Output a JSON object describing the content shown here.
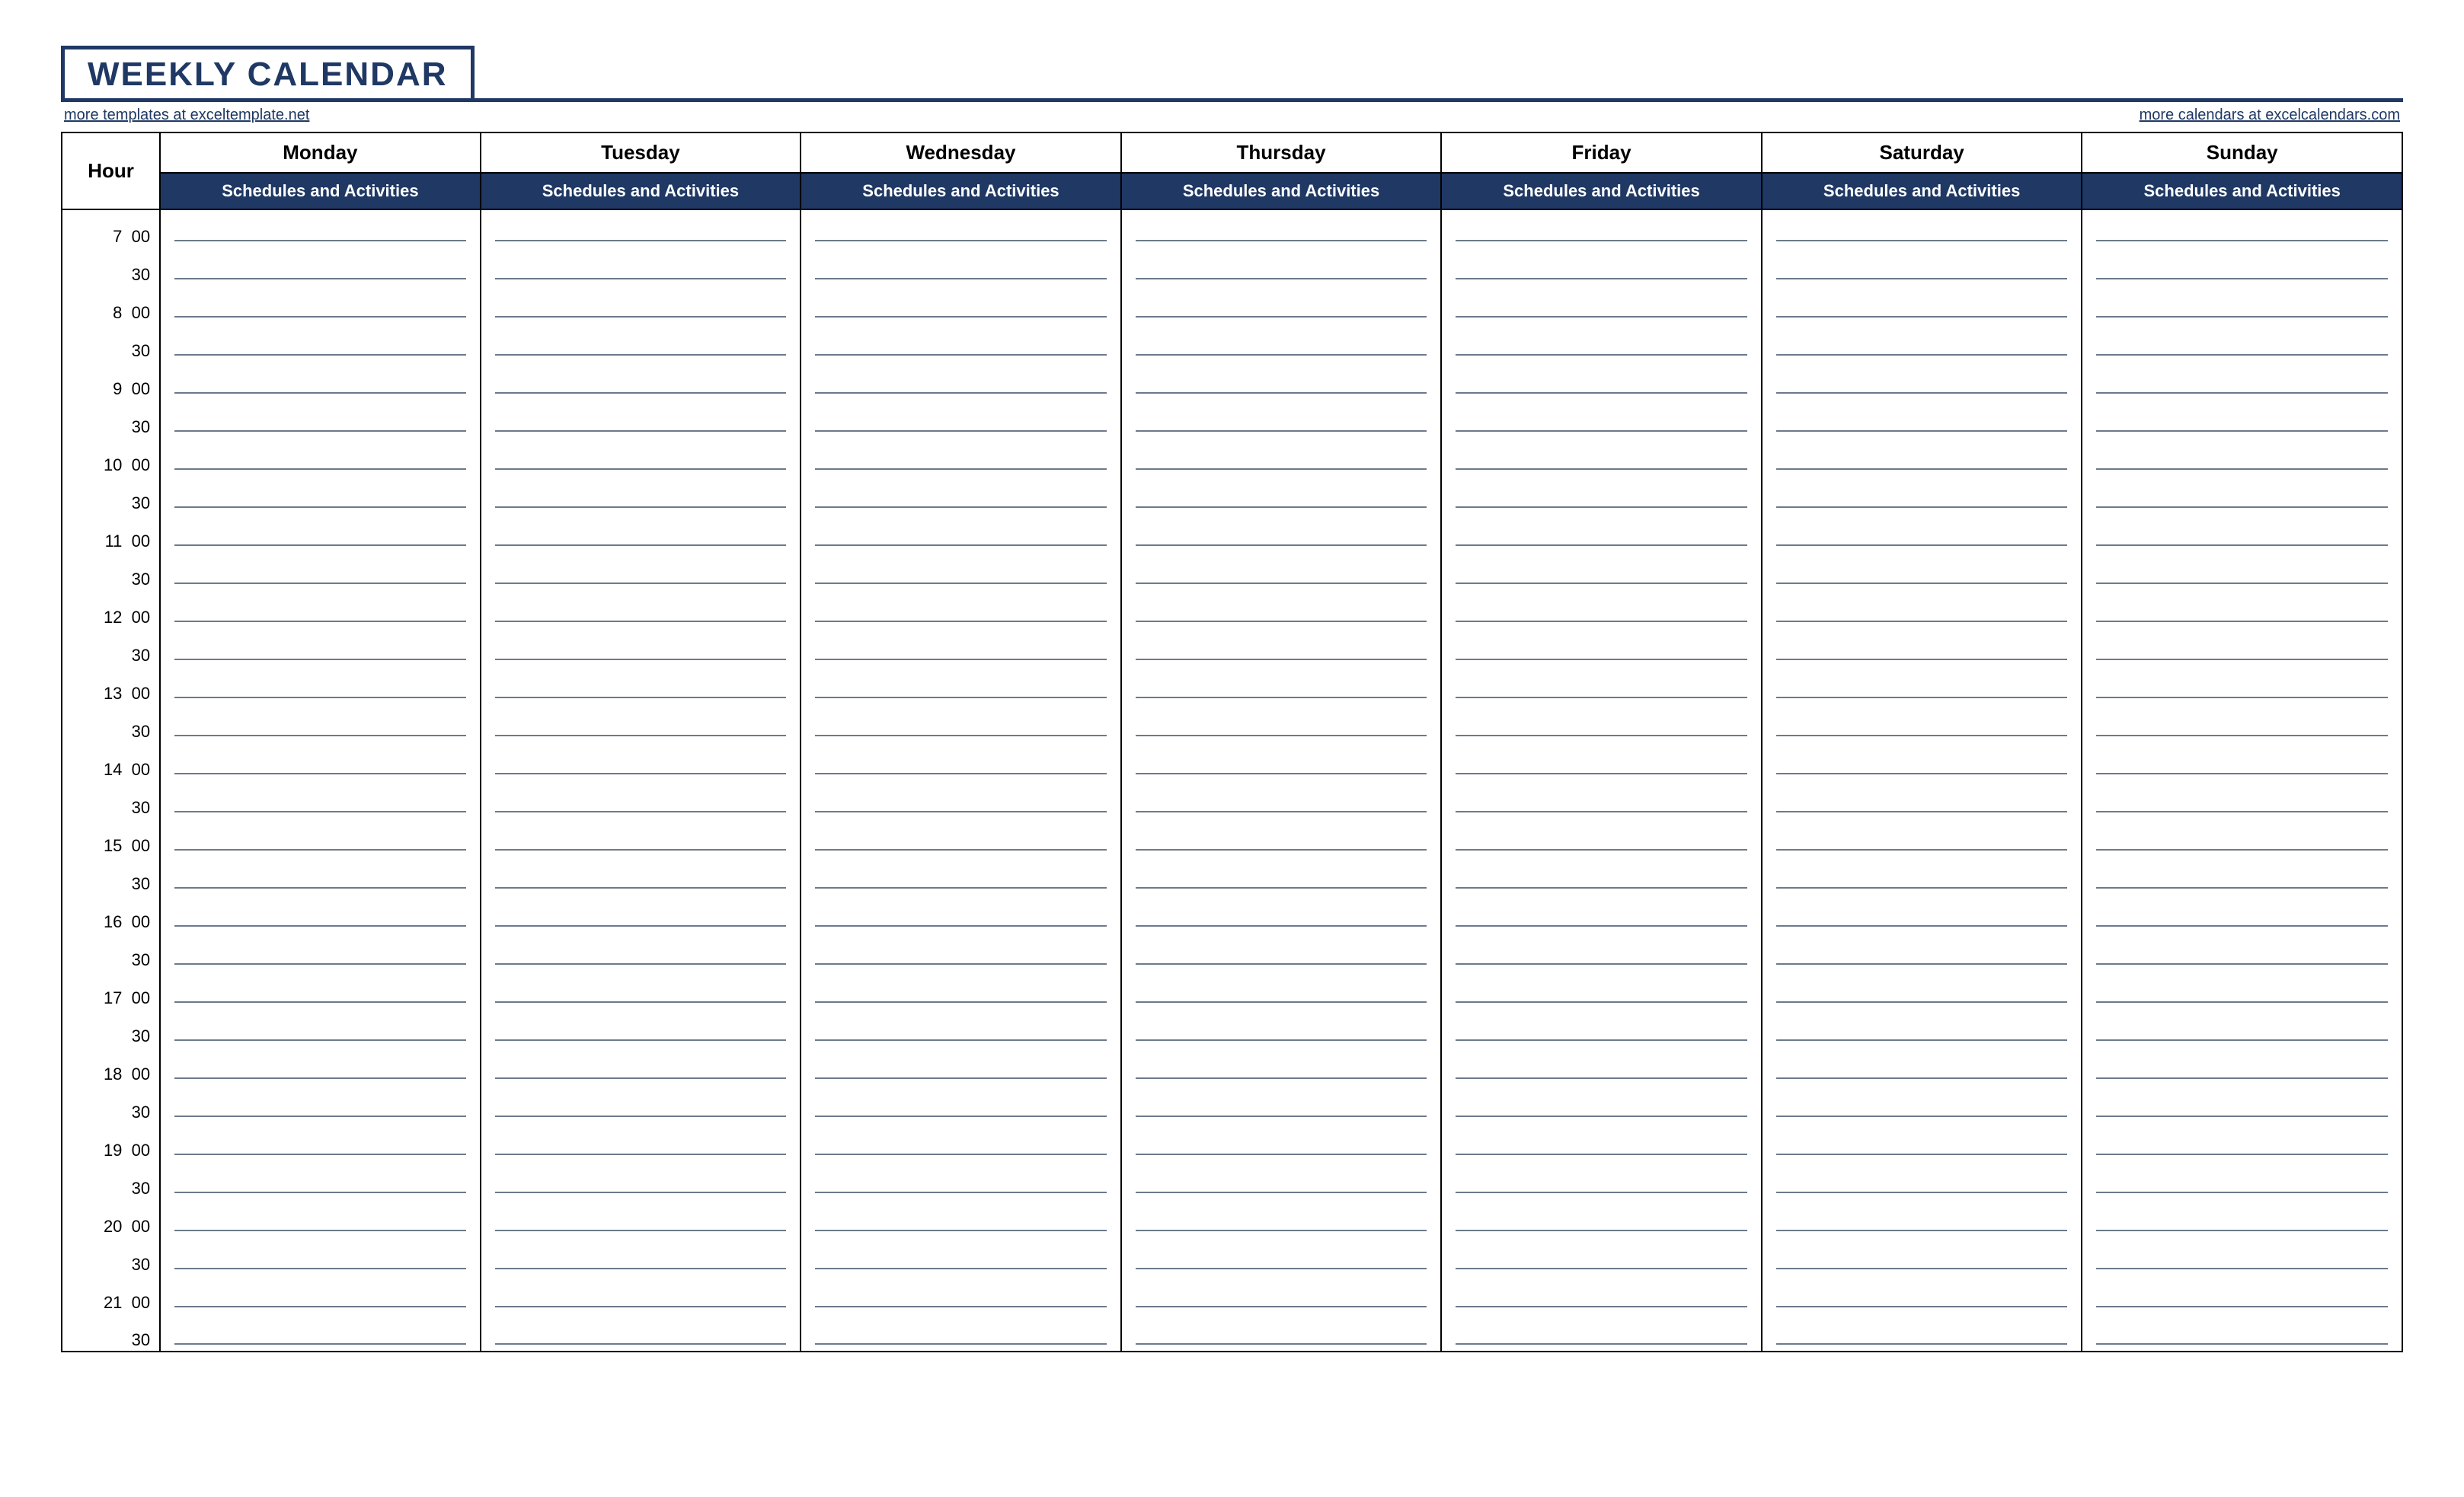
{
  "title": "WEEKLY CALENDAR",
  "links": {
    "left": "more templates at exceltemplate.net",
    "right": "more calendars at excelcalendars.com"
  },
  "headers": {
    "hour": "Hour",
    "days": [
      "Monday",
      "Tuesday",
      "Wednesday",
      "Thursday",
      "Friday",
      "Saturday",
      "Sunday"
    ],
    "sub": "Schedules and Activities"
  },
  "time_rows": [
    "7  00",
    "30",
    "8  00",
    "30",
    "9  00",
    "30",
    "10  00",
    "30",
    "11  00",
    "30",
    "12  00",
    "30",
    "13  00",
    "30",
    "14  00",
    "30",
    "15  00",
    "30",
    "16  00",
    "30",
    "17  00",
    "30",
    "18  00",
    "30",
    "19  00",
    "30",
    "20  00",
    "30",
    "21  00",
    "30"
  ]
}
